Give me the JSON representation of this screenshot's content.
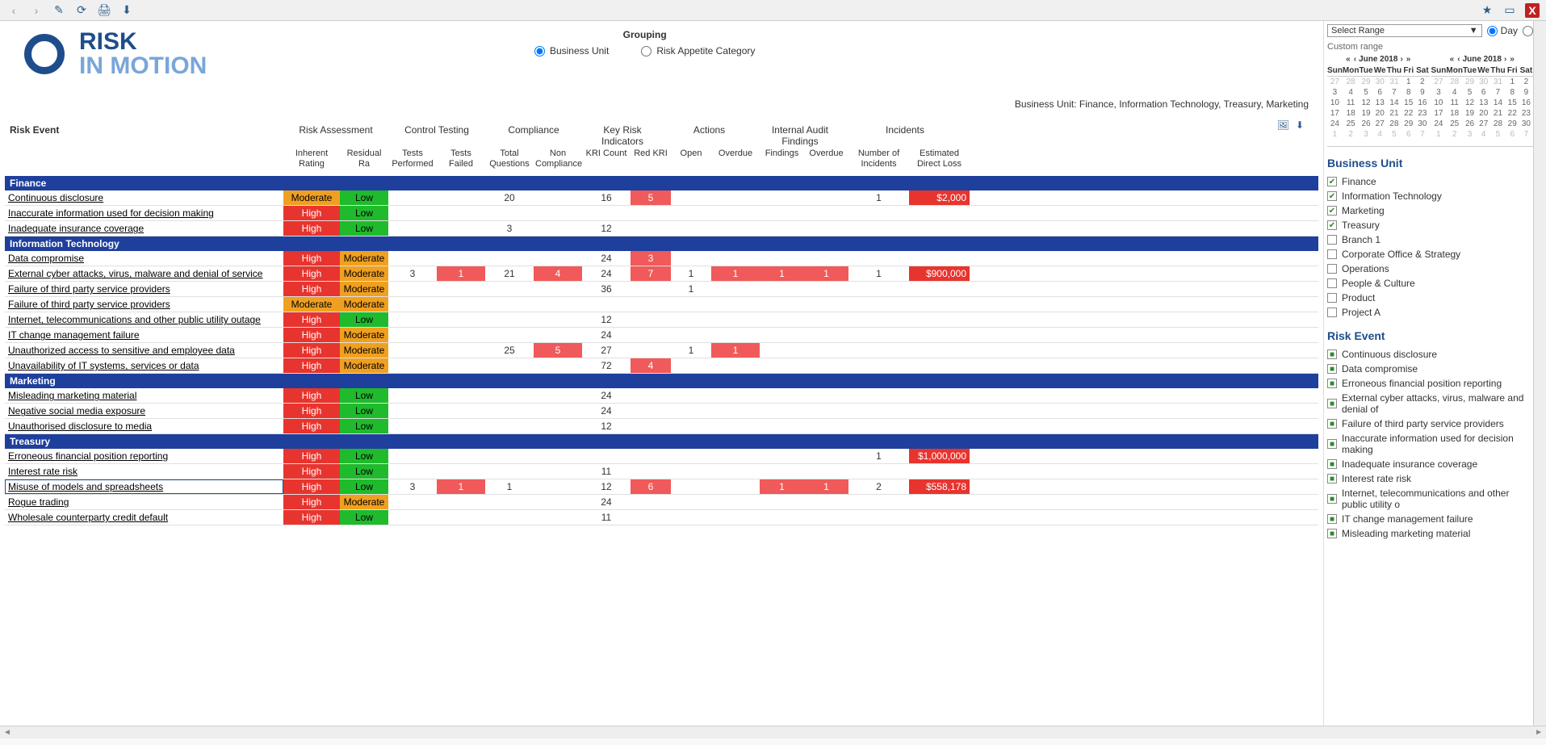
{
  "toolbar": {
    "back": "‹",
    "forward": "›",
    "edit": "✎",
    "refresh": "⟳",
    "print": "🖨",
    "download": "⬇",
    "star": "★",
    "minimize": "▭",
    "close": "X"
  },
  "logo": {
    "line1": "RISK",
    "line2": "IN MOTION"
  },
  "grouping": {
    "title": "Grouping",
    "opt1": "Business Unit",
    "opt2": "Risk Appetite Category"
  },
  "buLine": "Business Unit: Finance, Information Technology, Treasury, Marketing",
  "headers": {
    "riskEvent": "Risk Event",
    "groups": [
      "Risk Assessment",
      "Control Testing",
      "Compliance",
      "Key Risk Indicators",
      "Actions",
      "Internal Audit Findings",
      "Incidents"
    ],
    "sub": [
      "Inherent Rating",
      "Residual Ra",
      "Tests Performed",
      "Tests Failed",
      "Total Questions",
      "Non Compliance",
      "KRI Count",
      "Red KRI",
      "Open",
      "Overdue",
      "Findings",
      "Overdue",
      "Number of Incidents",
      "Estimated Direct Loss"
    ]
  },
  "groups": [
    {
      "name": "Finance",
      "rows": [
        {
          "event": "Continuous disclosure",
          "ih": "Moderate",
          "rr": "Low",
          "tp": "",
          "tf": "",
          "tq": "20",
          "nc": "",
          "kc": "16",
          "rk": "5",
          "op": "",
          "ov": "",
          "fi": "",
          "ov2": "",
          "ni": "1",
          "el": "$2,000"
        },
        {
          "event": "Inaccurate information used for decision making",
          "ih": "High",
          "rr": "Low",
          "tp": "",
          "tf": "",
          "tq": "",
          "nc": "",
          "kc": "",
          "rk": "",
          "op": "",
          "ov": "",
          "fi": "",
          "ov2": "",
          "ni": "",
          "el": ""
        },
        {
          "event": "Inadequate insurance coverage",
          "ih": "High",
          "rr": "Low",
          "tp": "",
          "tf": "",
          "tq": "3",
          "nc": "",
          "kc": "12",
          "rk": "",
          "op": "",
          "ov": "",
          "fi": "",
          "ov2": "",
          "ni": "",
          "el": ""
        }
      ]
    },
    {
      "name": "Information Technology",
      "rows": [
        {
          "event": "Data compromise",
          "ih": "High",
          "rr": "Moderate",
          "tp": "",
          "tf": "",
          "tq": "",
          "nc": "",
          "kc": "24",
          "rk": "3",
          "op": "",
          "ov": "",
          "fi": "",
          "ov2": "",
          "ni": "",
          "el": ""
        },
        {
          "event": "External cyber attacks, virus, malware and denial of service",
          "ih": "High",
          "rr": "Moderate",
          "tp": "3",
          "tf": "1",
          "tq": "21",
          "nc": "4",
          "kc": "24",
          "rk": "7",
          "op": "1",
          "ov": "1",
          "fi": "1",
          "ov2": "1",
          "ni": "1",
          "el": "$900,000"
        },
        {
          "event": "Failure of third party service providers",
          "ih": "High",
          "rr": "Moderate",
          "tp": "",
          "tf": "",
          "tq": "",
          "nc": "",
          "kc": "36",
          "rk": "",
          "op": "1",
          "ov": "",
          "fi": "",
          "ov2": "",
          "ni": "",
          "el": ""
        },
        {
          "event": "Failure of third party service providers",
          "ih": "Moderate",
          "rr": "Moderate",
          "tp": "",
          "tf": "",
          "tq": "",
          "nc": "",
          "kc": "",
          "rk": "",
          "op": "",
          "ov": "",
          "fi": "",
          "ov2": "",
          "ni": "",
          "el": ""
        },
        {
          "event": "Internet, telecommunications and other public utility outage",
          "ih": "High",
          "rr": "Low",
          "tp": "",
          "tf": "",
          "tq": "",
          "nc": "",
          "kc": "12",
          "rk": "",
          "op": "",
          "ov": "",
          "fi": "",
          "ov2": "",
          "ni": "",
          "el": ""
        },
        {
          "event": "IT change management failure",
          "ih": "High",
          "rr": "Moderate",
          "tp": "",
          "tf": "",
          "tq": "",
          "nc": "",
          "kc": "24",
          "rk": "",
          "op": "",
          "ov": "",
          "fi": "",
          "ov2": "",
          "ni": "",
          "el": ""
        },
        {
          "event": "Unauthorized access to sensitive and employee data",
          "ih": "High",
          "rr": "Moderate",
          "tp": "",
          "tf": "",
          "tq": "25",
          "nc": "5",
          "kc": "27",
          "rk": "",
          "op": "1",
          "ov": "1",
          "fi": "",
          "ov2": "",
          "ni": "",
          "el": ""
        },
        {
          "event": "Unavailability of IT systems, services or data",
          "ih": "High",
          "rr": "Moderate",
          "tp": "",
          "tf": "",
          "tq": "",
          "nc": "",
          "kc": "72",
          "rk": "4",
          "op": "",
          "ov": "",
          "fi": "",
          "ov2": "",
          "ni": "",
          "el": ""
        }
      ]
    },
    {
      "name": "Marketing",
      "rows": [
        {
          "event": "Misleading marketing material",
          "ih": "High",
          "rr": "Low",
          "tp": "",
          "tf": "",
          "tq": "",
          "nc": "",
          "kc": "24",
          "rk": "",
          "op": "",
          "ov": "",
          "fi": "",
          "ov2": "",
          "ni": "",
          "el": ""
        },
        {
          "event": "Negative social media exposure",
          "ih": "High",
          "rr": "Low",
          "tp": "",
          "tf": "",
          "tq": "",
          "nc": "",
          "kc": "24",
          "rk": "",
          "op": "",
          "ov": "",
          "fi": "",
          "ov2": "",
          "ni": "",
          "el": ""
        },
        {
          "event": "Unauthorised disclosure to media",
          "ih": "High",
          "rr": "Low",
          "tp": "",
          "tf": "",
          "tq": "",
          "nc": "",
          "kc": "12",
          "rk": "",
          "op": "",
          "ov": "",
          "fi": "",
          "ov2": "",
          "ni": "",
          "el": ""
        }
      ]
    },
    {
      "name": "Treasury",
      "rows": [
        {
          "event": "Erroneous financial position reporting",
          "ih": "High",
          "rr": "Low",
          "tp": "",
          "tf": "",
          "tq": "",
          "nc": "",
          "kc": "",
          "rk": "",
          "op": "",
          "ov": "",
          "fi": "",
          "ov2": "",
          "ni": "1",
          "el": "$1,000,000"
        },
        {
          "event": "Interest rate risk",
          "ih": "High",
          "rr": "Low",
          "tp": "",
          "tf": "",
          "tq": "",
          "nc": "",
          "kc": "11",
          "rk": "",
          "op": "",
          "ov": "",
          "fi": "",
          "ov2": "",
          "ni": "",
          "el": ""
        },
        {
          "event": "Misuse of models and spreadsheets",
          "ih": "High",
          "rr": "Low",
          "tp": "3",
          "tf": "1",
          "tq": "1",
          "nc": "",
          "kc": "12",
          "rk": "6",
          "op": "",
          "ov": "",
          "fi": "1",
          "ov2": "1",
          "ni": "2",
          "el": "$558,178",
          "selected": true
        },
        {
          "event": "Rogue trading",
          "ih": "High",
          "rr": "Moderate",
          "tp": "",
          "tf": "",
          "tq": "",
          "nc": "",
          "kc": "24",
          "rk": "",
          "op": "",
          "ov": "",
          "fi": "",
          "ov2": "",
          "ni": "",
          "el": ""
        },
        {
          "event": "Wholesale counterparty credit default",
          "ih": "High",
          "rr": "Low",
          "tp": "",
          "tf": "",
          "tq": "",
          "nc": "",
          "kc": "11",
          "rk": "",
          "op": "",
          "ov": "",
          "fi": "",
          "ov2": "",
          "ni": "",
          "el": ""
        }
      ]
    }
  ],
  "sidebar": {
    "selectRange": "Select Range",
    "day": "Day",
    "customRange": "Custom range",
    "month": "June 2018",
    "dayHdrs": [
      "Sun",
      "Mon",
      "Tue",
      "We",
      "Thu",
      "Fri",
      "Sat"
    ],
    "cal": [
      [
        "27",
        "28",
        "29",
        "30",
        "31",
        "1",
        "2"
      ],
      [
        "3",
        "4",
        "5",
        "6",
        "7",
        "8",
        "9"
      ],
      [
        "10",
        "11",
        "12",
        "13",
        "14",
        "15",
        "16"
      ],
      [
        "17",
        "18",
        "19",
        "20",
        "21",
        "22",
        "23"
      ],
      [
        "24",
        "25",
        "26",
        "27",
        "28",
        "29",
        "30"
      ],
      [
        "1",
        "2",
        "3",
        "4",
        "5",
        "6",
        "7"
      ]
    ],
    "buTitle": "Business Unit",
    "buItems": [
      {
        "label": "Finance",
        "checked": true
      },
      {
        "label": "Information Technology",
        "checked": true
      },
      {
        "label": "Marketing",
        "checked": true
      },
      {
        "label": "Treasury",
        "checked": true
      },
      {
        "label": "Branch 1",
        "checked": false
      },
      {
        "label": "Corporate Office & Strategy",
        "checked": false
      },
      {
        "label": "Operations",
        "checked": false
      },
      {
        "label": "People & Culture",
        "checked": false
      },
      {
        "label": "Product",
        "checked": false
      },
      {
        "label": "Project A",
        "checked": false
      }
    ],
    "reTitle": "Risk Event",
    "reItems": [
      "Continuous disclosure",
      "Data compromise",
      "Erroneous financial position reporting",
      "External cyber attacks, virus, malware and denial of",
      "Failure of third party service providers",
      "Inaccurate information used for decision making",
      "Inadequate insurance coverage",
      "Interest rate risk",
      "Internet, telecommunications and other public utility o",
      "IT change management failure",
      "Misleading marketing material"
    ]
  }
}
